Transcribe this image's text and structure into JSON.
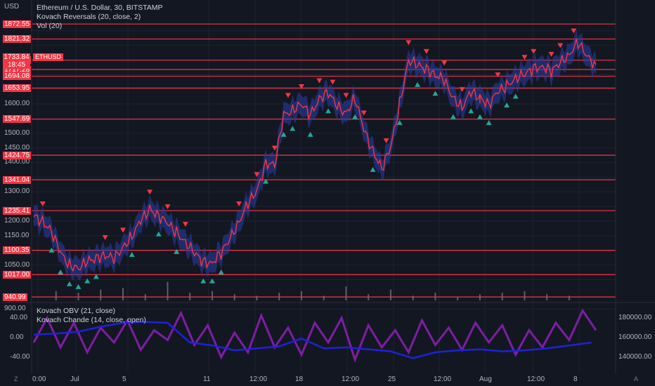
{
  "header": {
    "currency": "USD",
    "title": "Ethereum / U.S. Dollar, 30, BITSTAMP",
    "indicator1": "Kovach Reversals (20, close, 2)",
    "indicator2": "Vol (20)",
    "lower_indicator1": "Kovach OBV (21, close)",
    "lower_indicator2": "Kovach Chande (14, close, open)"
  },
  "price_tag": {
    "symbol": "ETHUSD",
    "price": "1733.84",
    "countdown": "18:45"
  },
  "corner": {
    "left": "Z",
    "right": "A"
  },
  "colors": {
    "background": "#131722",
    "level_line": "#f23645",
    "bear_marker": "#f23645",
    "bull_marker": "#26a69a",
    "price_line": "#f23645",
    "band": "#2a3ea8",
    "obv_line": "#1e22d8",
    "chande_line": "#7b1fa2"
  },
  "chart_data": [
    {
      "type": "line",
      "title": "Ethereum / U.S. Dollar, 30, BITSTAMP",
      "xlabel": "",
      "ylabel": "USD",
      "ylim": [
        900,
        1925
      ],
      "grid": true,
      "x_ticks": [
        "0:00",
        "Jul",
        "5",
        "11",
        "12:00",
        "18",
        "12:00",
        "25",
        "12:00",
        "Aug",
        "12:00",
        "8"
      ],
      "y_ticks": [
        900,
        1000,
        1050,
        1100,
        1150,
        1200,
        1250,
        1300,
        1350,
        1400,
        1450,
        1500,
        1550,
        1600,
        1650,
        1700,
        1750,
        1800,
        1850
      ],
      "horizontal_levels": [
        1872.55,
        1821.32,
        1748.98,
        1717.28,
        1694.08,
        1653.95,
        1547.69,
        1424.75,
        1341.04,
        1235.41,
        1100.35,
        1017.0,
        940.99
      ],
      "series": [
        {
          "x": [
            0,
            2,
            4,
            6,
            8,
            10,
            12,
            14,
            16,
            18,
            20,
            22,
            24,
            26,
            28,
            30,
            32,
            34,
            36,
            38,
            40,
            42,
            44,
            46,
            48,
            50,
            52,
            54,
            56,
            58,
            60,
            62,
            64,
            66,
            68,
            70,
            72,
            74,
            76,
            78,
            80,
            82,
            84,
            86,
            88,
            90,
            92,
            94,
            96,
            98,
            100
          ],
          "values": [
            1215,
            1200,
            1165,
            1090,
            1050,
            1040,
            1060,
            1075,
            1085,
            1070,
            1110,
            1150,
            1200,
            1240,
            1220,
            1190,
            1160,
            1130,
            1090,
            1060,
            1060,
            1090,
            1140,
            1200,
            1260,
            1300,
            1400,
            1390,
            1560,
            1580,
            1600,
            1560,
            1620,
            1640,
            1590,
            1570,
            1620,
            1510,
            1440,
            1380,
            1450,
            1600,
            1750,
            1730,
            1720,
            1700,
            1680,
            1620,
            1590,
            1640,
            1620
          ]
        },
        {
          "x": [
            100,
            102,
            104,
            106,
            108,
            110,
            112,
            114,
            116,
            118,
            120,
            122,
            124,
            126
          ],
          "values": [
            1620,
            1600,
            1640,
            1660,
            1690,
            1700,
            1720,
            1730,
            1710,
            1740,
            1770,
            1810,
            1760,
            1734
          ]
        }
      ],
      "reversal_markers": {
        "bearish_x": [
          2,
          16,
          20,
          26,
          30,
          34,
          46,
          50,
          54,
          57,
          60,
          64,
          67,
          70,
          74,
          79,
          84,
          88,
          92,
          96,
          104,
          110,
          112,
          116,
          118,
          121
        ],
        "bullish_x": [
          4,
          6,
          8,
          10,
          12,
          14,
          22,
          28,
          32,
          38,
          40,
          42,
          52,
          56,
          58,
          62,
          66,
          72,
          76,
          82,
          86,
          90,
          94,
          98,
          100,
          102,
          106,
          108
        ]
      },
      "volume": {
        "x": [
          5,
          10,
          15,
          20,
          25,
          30,
          35,
          40,
          45,
          50,
          55,
          60,
          65,
          70,
          75,
          80,
          85,
          90,
          95,
          100,
          105,
          110,
          115,
          120
        ],
        "values": [
          6,
          5,
          7,
          8,
          4,
          12,
          5,
          6,
          4,
          3,
          5,
          6,
          3,
          9,
          4,
          7,
          3,
          5,
          2,
          4,
          5,
          6,
          4,
          3
        ]
      }
    },
    {
      "type": "line",
      "title": "Kovach OBV (21, close)",
      "ylim": [
        -60,
        60
      ],
      "y_ticks_left": [
        40,
        0,
        -40
      ],
      "y_ticks_right": [
        180000,
        160000,
        140000
      ],
      "series": [
        {
          "name": "Kovach OBV (21, close)",
          "x": [
            0,
            5,
            10,
            15,
            20,
            25,
            30,
            35,
            40,
            45,
            50,
            55,
            60,
            65,
            70,
            75,
            80,
            85,
            90,
            95,
            100,
            105,
            110,
            115,
            120,
            125
          ],
          "values": [
            163000,
            164000,
            166000,
            171000,
            175000,
            176000,
            175000,
            155000,
            152000,
            147000,
            149000,
            151000,
            159000,
            149000,
            150000,
            148000,
            146000,
            139000,
            145000,
            147000,
            148000,
            146000,
            147000,
            149000,
            152000,
            155000
          ]
        },
        {
          "name": "Kovach Chande (14, close, open)",
          "x": [
            0,
            3,
            6,
            9,
            12,
            15,
            18,
            21,
            24,
            27,
            30,
            33,
            36,
            39,
            42,
            45,
            48,
            51,
            54,
            57,
            60,
            63,
            66,
            69,
            72,
            75,
            78,
            81,
            84,
            87,
            90,
            93,
            96,
            99,
            102,
            105,
            108,
            111,
            114,
            117,
            120,
            123,
            126
          ],
          "values": [
            -10,
            40,
            -20,
            30,
            -30,
            20,
            -10,
            35,
            -25,
            15,
            -5,
            50,
            -15,
            25,
            -40,
            10,
            -30,
            45,
            -20,
            20,
            -35,
            30,
            -10,
            40,
            -45,
            25,
            -20,
            15,
            -30,
            35,
            -15,
            20,
            -25,
            30,
            -10,
            25,
            -35,
            15,
            -20,
            30,
            -5,
            55,
            15
          ]
        }
      ]
    }
  ]
}
